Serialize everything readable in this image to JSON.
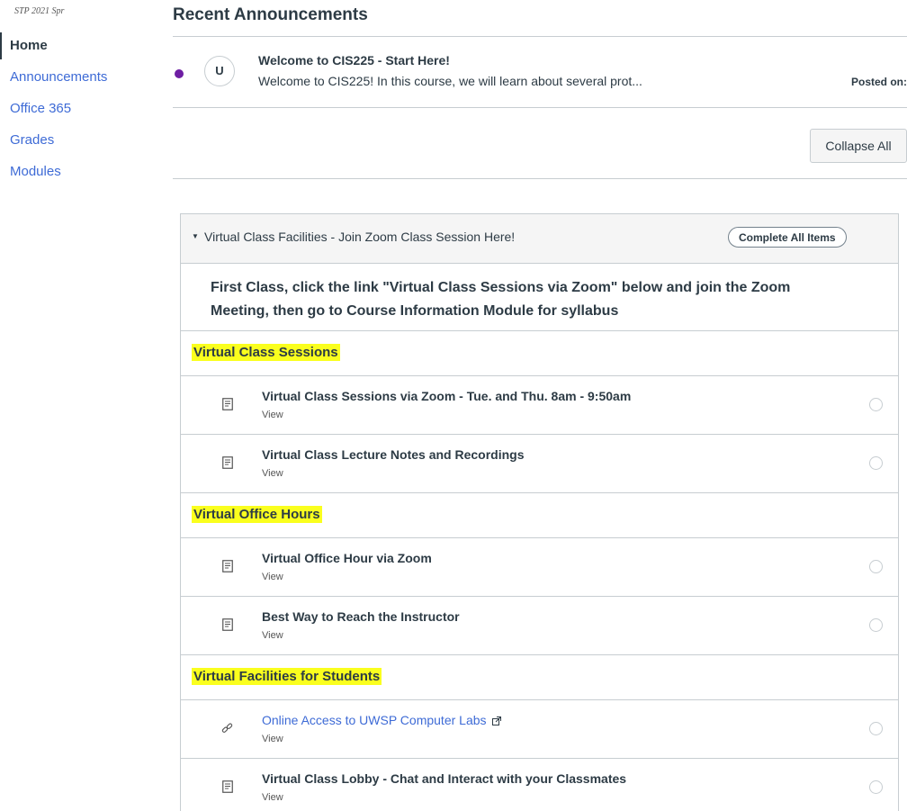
{
  "sidebar": {
    "term": "STP 2021 Spr",
    "items": [
      {
        "label": "Home"
      },
      {
        "label": "Announcements"
      },
      {
        "label": "Office 365"
      },
      {
        "label": "Grades"
      },
      {
        "label": "Modules"
      }
    ]
  },
  "announcements": {
    "title": "Recent Announcements",
    "item": {
      "avatar_initial": "U",
      "title": "Welcome to CIS225 - Start Here!",
      "message": "Welcome to CIS225!  In this course, we will learn about several prot...",
      "posted_label": "Posted on:"
    }
  },
  "collapse_all_label": "Collapse All",
  "module": {
    "title": "Virtual Class Facilities - Join Zoom Class Session Here!",
    "complete_all_label": "Complete All Items",
    "intro_text": "First Class, click the link \"Virtual Class Sessions via Zoom\" below and join the Zoom Meeting, then go to Course Information Module for syllabus",
    "view_label": "View",
    "sections": [
      {
        "header": "Virtual Class Sessions",
        "items": [
          {
            "title": "Virtual Class Sessions via Zoom - Tue. and Thu. 8am - 9:50am"
          },
          {
            "title": "Virtual Class Lecture Notes and Recordings"
          }
        ]
      },
      {
        "header": "Virtual Office Hours",
        "items": [
          {
            "title": "Virtual Office Hour via Zoom"
          },
          {
            "title": "Best Way to Reach the Instructor"
          }
        ]
      },
      {
        "header": "Virtual Facilities for Students",
        "items": [
          {
            "title": "Online Access to UWSP Computer Labs"
          },
          {
            "title": "Virtual Class Lobby - Chat and Interact with your Classmates"
          }
        ]
      }
    ]
  },
  "colors": {
    "link": "#3e6bd6",
    "text": "#2d3b45",
    "highlight": "#faff1e",
    "unread_dot": "#6e1ea3",
    "border": "#c7cdd1"
  },
  "icons": {
    "page": "document-icon",
    "link": "chain-link-icon",
    "external": "external-link-icon",
    "caret": "caret-down-icon",
    "unread": "unread-dot-icon"
  }
}
